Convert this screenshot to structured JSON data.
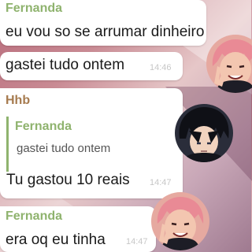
{
  "messages": [
    {
      "sender": "Fernanda",
      "text": "eu vou so se arrumar dinheiro"
    },
    {
      "text": "gastei tudo ontem",
      "time": "14:46"
    },
    {
      "sender": "Hhb",
      "reply": {
        "sender": "Fernanda",
        "text": "gastei tudo ontem"
      },
      "text": "Tu gastou 10 reais",
      "time": "14:47"
    },
    {
      "sender": "Fernanda",
      "text": "era oq eu tinha",
      "time": "14:47"
    }
  ],
  "colors": {
    "fernanda_name": "#8fb36e",
    "hhb_name": "#a67a4e",
    "timestamp": "#c7c7c7"
  },
  "icons": [
    "avatar-pink-haired-boy",
    "avatar-dark-haired-boy",
    "avatar-pink-haired-boy"
  ]
}
